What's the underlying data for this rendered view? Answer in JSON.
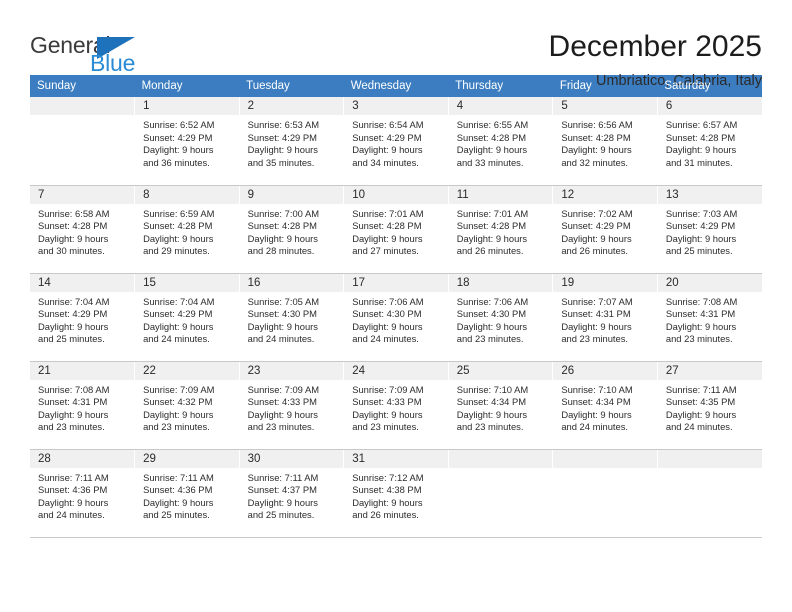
{
  "logo": {
    "word_top": "General",
    "word_bottom": "Blue",
    "triangle_icon": "triangle-icon",
    "color_dark": "#3b3b3b",
    "color_blue": "#2b8bd4",
    "color_triangle": "#1e72bb"
  },
  "header": {
    "title": "December 2025",
    "subtitle": "Umbriatico, Calabria, Italy"
  },
  "theme": {
    "header_bg": "#3b7dc0",
    "daynum_bg": "#f0f0f0",
    "grid_line": "#c8c8c8"
  },
  "weekdays": [
    "Sunday",
    "Monday",
    "Tuesday",
    "Wednesday",
    "Thursday",
    "Friday",
    "Saturday"
  ],
  "weeks": [
    [
      {
        "day": "",
        "sunrise": "",
        "sunset": "",
        "daylight1": "",
        "daylight2": ""
      },
      {
        "day": "1",
        "sunrise": "Sunrise: 6:52 AM",
        "sunset": "Sunset: 4:29 PM",
        "daylight1": "Daylight: 9 hours",
        "daylight2": "and 36 minutes."
      },
      {
        "day": "2",
        "sunrise": "Sunrise: 6:53 AM",
        "sunset": "Sunset: 4:29 PM",
        "daylight1": "Daylight: 9 hours",
        "daylight2": "and 35 minutes."
      },
      {
        "day": "3",
        "sunrise": "Sunrise: 6:54 AM",
        "sunset": "Sunset: 4:29 PM",
        "daylight1": "Daylight: 9 hours",
        "daylight2": "and 34 minutes."
      },
      {
        "day": "4",
        "sunrise": "Sunrise: 6:55 AM",
        "sunset": "Sunset: 4:28 PM",
        "daylight1": "Daylight: 9 hours",
        "daylight2": "and 33 minutes."
      },
      {
        "day": "5",
        "sunrise": "Sunrise: 6:56 AM",
        "sunset": "Sunset: 4:28 PM",
        "daylight1": "Daylight: 9 hours",
        "daylight2": "and 32 minutes."
      },
      {
        "day": "6",
        "sunrise": "Sunrise: 6:57 AM",
        "sunset": "Sunset: 4:28 PM",
        "daylight1": "Daylight: 9 hours",
        "daylight2": "and 31 minutes."
      }
    ],
    [
      {
        "day": "7",
        "sunrise": "Sunrise: 6:58 AM",
        "sunset": "Sunset: 4:28 PM",
        "daylight1": "Daylight: 9 hours",
        "daylight2": "and 30 minutes."
      },
      {
        "day": "8",
        "sunrise": "Sunrise: 6:59 AM",
        "sunset": "Sunset: 4:28 PM",
        "daylight1": "Daylight: 9 hours",
        "daylight2": "and 29 minutes."
      },
      {
        "day": "9",
        "sunrise": "Sunrise: 7:00 AM",
        "sunset": "Sunset: 4:28 PM",
        "daylight1": "Daylight: 9 hours",
        "daylight2": "and 28 minutes."
      },
      {
        "day": "10",
        "sunrise": "Sunrise: 7:01 AM",
        "sunset": "Sunset: 4:28 PM",
        "daylight1": "Daylight: 9 hours",
        "daylight2": "and 27 minutes."
      },
      {
        "day": "11",
        "sunrise": "Sunrise: 7:01 AM",
        "sunset": "Sunset: 4:28 PM",
        "daylight1": "Daylight: 9 hours",
        "daylight2": "and 26 minutes."
      },
      {
        "day": "12",
        "sunrise": "Sunrise: 7:02 AM",
        "sunset": "Sunset: 4:29 PM",
        "daylight1": "Daylight: 9 hours",
        "daylight2": "and 26 minutes."
      },
      {
        "day": "13",
        "sunrise": "Sunrise: 7:03 AM",
        "sunset": "Sunset: 4:29 PM",
        "daylight1": "Daylight: 9 hours",
        "daylight2": "and 25 minutes."
      }
    ],
    [
      {
        "day": "14",
        "sunrise": "Sunrise: 7:04 AM",
        "sunset": "Sunset: 4:29 PM",
        "daylight1": "Daylight: 9 hours",
        "daylight2": "and 25 minutes."
      },
      {
        "day": "15",
        "sunrise": "Sunrise: 7:04 AM",
        "sunset": "Sunset: 4:29 PM",
        "daylight1": "Daylight: 9 hours",
        "daylight2": "and 24 minutes."
      },
      {
        "day": "16",
        "sunrise": "Sunrise: 7:05 AM",
        "sunset": "Sunset: 4:30 PM",
        "daylight1": "Daylight: 9 hours",
        "daylight2": "and 24 minutes."
      },
      {
        "day": "17",
        "sunrise": "Sunrise: 7:06 AM",
        "sunset": "Sunset: 4:30 PM",
        "daylight1": "Daylight: 9 hours",
        "daylight2": "and 24 minutes."
      },
      {
        "day": "18",
        "sunrise": "Sunrise: 7:06 AM",
        "sunset": "Sunset: 4:30 PM",
        "daylight1": "Daylight: 9 hours",
        "daylight2": "and 23 minutes."
      },
      {
        "day": "19",
        "sunrise": "Sunrise: 7:07 AM",
        "sunset": "Sunset: 4:31 PM",
        "daylight1": "Daylight: 9 hours",
        "daylight2": "and 23 minutes."
      },
      {
        "day": "20",
        "sunrise": "Sunrise: 7:08 AM",
        "sunset": "Sunset: 4:31 PM",
        "daylight1": "Daylight: 9 hours",
        "daylight2": "and 23 minutes."
      }
    ],
    [
      {
        "day": "21",
        "sunrise": "Sunrise: 7:08 AM",
        "sunset": "Sunset: 4:31 PM",
        "daylight1": "Daylight: 9 hours",
        "daylight2": "and 23 minutes."
      },
      {
        "day": "22",
        "sunrise": "Sunrise: 7:09 AM",
        "sunset": "Sunset: 4:32 PM",
        "daylight1": "Daylight: 9 hours",
        "daylight2": "and 23 minutes."
      },
      {
        "day": "23",
        "sunrise": "Sunrise: 7:09 AM",
        "sunset": "Sunset: 4:33 PM",
        "daylight1": "Daylight: 9 hours",
        "daylight2": "and 23 minutes."
      },
      {
        "day": "24",
        "sunrise": "Sunrise: 7:09 AM",
        "sunset": "Sunset: 4:33 PM",
        "daylight1": "Daylight: 9 hours",
        "daylight2": "and 23 minutes."
      },
      {
        "day": "25",
        "sunrise": "Sunrise: 7:10 AM",
        "sunset": "Sunset: 4:34 PM",
        "daylight1": "Daylight: 9 hours",
        "daylight2": "and 23 minutes."
      },
      {
        "day": "26",
        "sunrise": "Sunrise: 7:10 AM",
        "sunset": "Sunset: 4:34 PM",
        "daylight1": "Daylight: 9 hours",
        "daylight2": "and 24 minutes."
      },
      {
        "day": "27",
        "sunrise": "Sunrise: 7:11 AM",
        "sunset": "Sunset: 4:35 PM",
        "daylight1": "Daylight: 9 hours",
        "daylight2": "and 24 minutes."
      }
    ],
    [
      {
        "day": "28",
        "sunrise": "Sunrise: 7:11 AM",
        "sunset": "Sunset: 4:36 PM",
        "daylight1": "Daylight: 9 hours",
        "daylight2": "and 24 minutes."
      },
      {
        "day": "29",
        "sunrise": "Sunrise: 7:11 AM",
        "sunset": "Sunset: 4:36 PM",
        "daylight1": "Daylight: 9 hours",
        "daylight2": "and 25 minutes."
      },
      {
        "day": "30",
        "sunrise": "Sunrise: 7:11 AM",
        "sunset": "Sunset: 4:37 PM",
        "daylight1": "Daylight: 9 hours",
        "daylight2": "and 25 minutes."
      },
      {
        "day": "31",
        "sunrise": "Sunrise: 7:12 AM",
        "sunset": "Sunset: 4:38 PM",
        "daylight1": "Daylight: 9 hours",
        "daylight2": "and 26 minutes."
      },
      {
        "day": "",
        "sunrise": "",
        "sunset": "",
        "daylight1": "",
        "daylight2": ""
      },
      {
        "day": "",
        "sunrise": "",
        "sunset": "",
        "daylight1": "",
        "daylight2": ""
      },
      {
        "day": "",
        "sunrise": "",
        "sunset": "",
        "daylight1": "",
        "daylight2": ""
      }
    ]
  ]
}
